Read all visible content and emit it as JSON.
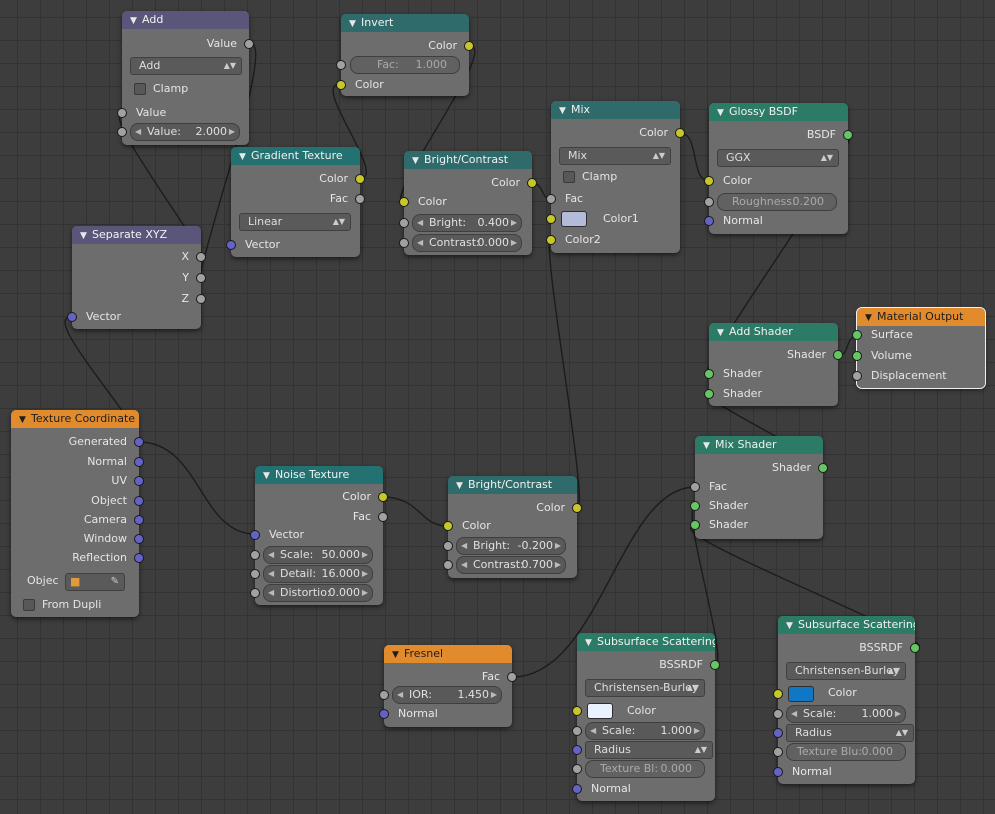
{
  "colors": {
    "socket_color": "#c7c729",
    "socket_value": "#a1a1a1",
    "socket_vector": "#6363c7",
    "socket_shader": "#63c763",
    "mix_color1": "#b3bbd8",
    "ss1_color": "#eaf2ff",
    "ss2_color": "#0f77c3"
  },
  "nodes": {
    "add": {
      "title": "Add",
      "out_value": "Value",
      "op": "Add",
      "clamp": "Clamp",
      "in_value": "Value",
      "field_label": "Value:",
      "field_value": "2.000"
    },
    "invert": {
      "title": "Invert",
      "out_color": "Color",
      "fac_label": "Fac:",
      "fac_value": "1.000",
      "in_color": "Color"
    },
    "gradient": {
      "title": "Gradient Texture",
      "out_color": "Color",
      "out_fac": "Fac",
      "type": "Linear",
      "in_vector": "Vector"
    },
    "bc1": {
      "title": "Bright/Contrast",
      "out_color": "Color",
      "in_color": "Color",
      "bright_label": "Bright:",
      "bright_value": "0.400",
      "contrast_label": "Contrast:",
      "contrast_value": "0.000"
    },
    "mix": {
      "title": "Mix",
      "out_color": "Color",
      "blend": "Mix",
      "clamp": "Clamp",
      "fac": "Fac",
      "color1": "Color1",
      "color2": "Color2"
    },
    "glossy": {
      "title": "Glossy BSDF",
      "out_bsdf": "BSDF",
      "dist": "GGX",
      "in_color": "Color",
      "rough_label": "Roughness:",
      "rough_value": "0.200",
      "normal": "Normal"
    },
    "sepxyz": {
      "title": "Separate XYZ",
      "x": "X",
      "y": "Y",
      "z": "Z",
      "in_vector": "Vector"
    },
    "addshader": {
      "title": "Add Shader",
      "out_shader": "Shader",
      "in1": "Shader",
      "in2": "Shader"
    },
    "matout": {
      "title": "Material Output",
      "surface": "Surface",
      "volume": "Volume",
      "displacement": "Displacement"
    },
    "texcoord": {
      "title": "Texture Coordinate",
      "generated": "Generated",
      "normal": "Normal",
      "uv": "UV",
      "object": "Object",
      "camera": "Camera",
      "window": "Window",
      "reflection": "Reflection",
      "obj_label": "Objec",
      "from_dupli": "From Dupli"
    },
    "noise": {
      "title": "Noise Texture",
      "out_color": "Color",
      "out_fac": "Fac",
      "in_vector": "Vector",
      "scale_label": "Scale:",
      "scale_value": "50.000",
      "detail_label": "Detail:",
      "detail_value": "16.000",
      "dist_label": "Distortio:",
      "dist_value": "0.000"
    },
    "bc2": {
      "title": "Bright/Contrast",
      "out_color": "Color",
      "in_color": "Color",
      "bright_label": "Bright:",
      "bright_value": "-0.200",
      "contrast_label": "Contrast:",
      "contrast_value": "0.700"
    },
    "mixshader": {
      "title": "Mix Shader",
      "out_shader": "Shader",
      "fac": "Fac",
      "in1": "Shader",
      "in2": "Shader"
    },
    "fresnel": {
      "title": "Fresnel",
      "out_fac": "Fac",
      "ior_label": "IOR:",
      "ior_value": "1.450",
      "normal": "Normal"
    },
    "ss1": {
      "title": "Subsurface Scattering",
      "out": "BSSRDF",
      "falloff": "Christensen-Burley",
      "color": "Color",
      "scale_label": "Scale:",
      "scale_value": "1.000",
      "radius": "Radius",
      "blur_label": "Texture Bl:",
      "blur_value": "0.000",
      "normal": "Normal"
    },
    "ss2": {
      "title": "Subsurface Scattering",
      "out": "BSSRDF",
      "falloff": "Christensen-Burley",
      "color": "Color",
      "scale_label": "Scale:",
      "scale_value": "1.000",
      "radius": "Radius",
      "blur_label": "Texture Blu:",
      "blur_value": "0.000",
      "normal": "Normal"
    }
  }
}
